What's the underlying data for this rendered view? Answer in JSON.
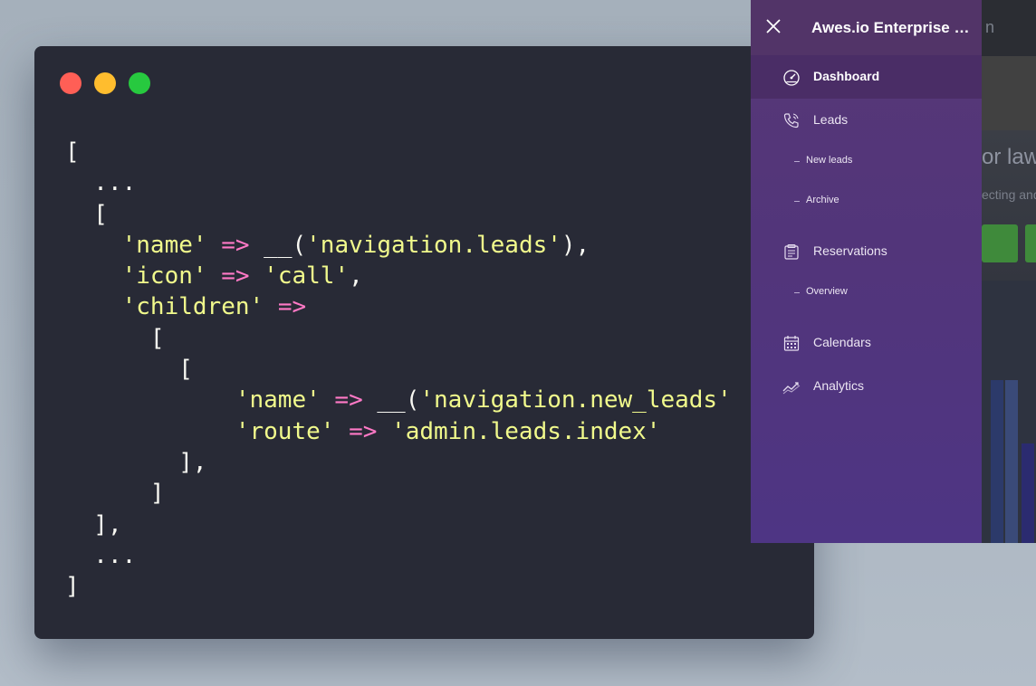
{
  "background_app": {
    "topbar_text": "n",
    "hero_title": "or law",
    "hero_subtitle": "ecting and"
  },
  "terminal": {
    "traffic_lights": {
      "close_color": "#ff5f56",
      "minimize_color": "#ffbd2e",
      "maximize_color": "#27c93f"
    },
    "code_lines": [
      [
        {
          "t": "punct",
          "v": "["
        }
      ],
      [
        {
          "t": "punct",
          "v": "  ..."
        }
      ],
      [
        {
          "t": "punct",
          "v": "  ["
        }
      ],
      [
        {
          "t": "punct",
          "v": "    "
        },
        {
          "t": "str",
          "v": "'name'"
        },
        {
          "t": "punct",
          "v": " "
        },
        {
          "t": "op",
          "v": "=>"
        },
        {
          "t": "punct",
          "v": " __("
        },
        {
          "t": "str",
          "v": "'navigation.leads'"
        },
        {
          "t": "punct",
          "v": "),"
        }
      ],
      [
        {
          "t": "punct",
          "v": "    "
        },
        {
          "t": "str",
          "v": "'icon'"
        },
        {
          "t": "punct",
          "v": " "
        },
        {
          "t": "op",
          "v": "=>"
        },
        {
          "t": "punct",
          "v": " "
        },
        {
          "t": "str",
          "v": "'call'"
        },
        {
          "t": "punct",
          "v": ","
        }
      ],
      [
        {
          "t": "punct",
          "v": "    "
        },
        {
          "t": "str",
          "v": "'children'"
        },
        {
          "t": "punct",
          "v": " "
        },
        {
          "t": "op",
          "v": "=>"
        }
      ],
      [
        {
          "t": "punct",
          "v": "      ["
        }
      ],
      [
        {
          "t": "punct",
          "v": "        ["
        }
      ],
      [
        {
          "t": "punct",
          "v": "            "
        },
        {
          "t": "str",
          "v": "'name'"
        },
        {
          "t": "punct",
          "v": " "
        },
        {
          "t": "op",
          "v": "=>"
        },
        {
          "t": "punct",
          "v": " __("
        },
        {
          "t": "str",
          "v": "'navigation.new_leads'"
        }
      ],
      [
        {
          "t": "punct",
          "v": "            "
        },
        {
          "t": "str",
          "v": "'route'"
        },
        {
          "t": "punct",
          "v": " "
        },
        {
          "t": "op",
          "v": "=>"
        },
        {
          "t": "punct",
          "v": " "
        },
        {
          "t": "str",
          "v": "'admin.leads.index'"
        }
      ],
      [
        {
          "t": "punct",
          "v": "        ],"
        }
      ],
      [
        {
          "t": "punct",
          "v": "      ]"
        }
      ],
      [
        {
          "t": "punct",
          "v": "  ],"
        }
      ],
      [
        {
          "t": "punct",
          "v": "  ..."
        }
      ],
      [
        {
          "t": "punct",
          "v": "]"
        }
      ]
    ]
  },
  "sidebar": {
    "title": "Awes.io Enterprise E...",
    "items": [
      {
        "label": "Dashboard",
        "icon": "speedometer-icon",
        "active": true
      },
      {
        "label": "Leads",
        "icon": "phone-icon",
        "active": false
      },
      {
        "label": "New leads",
        "sub": true
      },
      {
        "label": "Archive",
        "sub": true
      },
      {
        "label": "Reservations",
        "icon": "clipboard-icon",
        "active": false
      },
      {
        "label": "Overview",
        "sub": true
      },
      {
        "label": "Calendars",
        "icon": "calendar-icon",
        "active": false
      },
      {
        "label": "Analytics",
        "icon": "trend-line-icon",
        "active": false
      }
    ]
  }
}
